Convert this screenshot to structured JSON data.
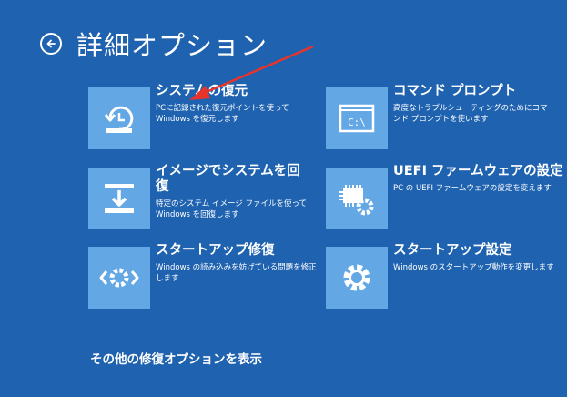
{
  "header": {
    "title": "詳細オプション"
  },
  "tiles": [
    {
      "title": "システムの復元",
      "desc": "PCに記録された復元ポイントを使って Windows を復元します"
    },
    {
      "title": "イメージでシステムを回復",
      "desc": "特定のシステム イメージ ファイルを使って Windows を回復します"
    },
    {
      "title": "スタートアップ修復",
      "desc": "Windows の読み込みを妨げている問題を修正します"
    },
    {
      "title": "コマンド プロンプト",
      "desc": "高度なトラブルシューティングのためにコマンド プロンプトを使います"
    },
    {
      "title": "UEFI ファームウェアの設定",
      "desc": "PC の UEFI ファームウェアの設定を変えます"
    },
    {
      "title": "スタートアップ設定",
      "desc": "Windows のスタートアップ動作を変更します"
    }
  ],
  "icons": {
    "back": "back-arrow-icon",
    "restore": "system-restore-icon",
    "image_recovery": "system-image-recovery-icon",
    "startup_repair": "startup-repair-icon",
    "cmd": "command-prompt-icon",
    "cmd_text": "C:\\",
    "uefi": "uefi-chip-gear-icon",
    "startup_settings": "gear-icon"
  },
  "footer": {
    "more_link": "その他の修復オプションを表示"
  },
  "colors": {
    "background": "#1f62b0",
    "tile": "#63a7e4",
    "annotation_arrow": "#e8342a"
  }
}
